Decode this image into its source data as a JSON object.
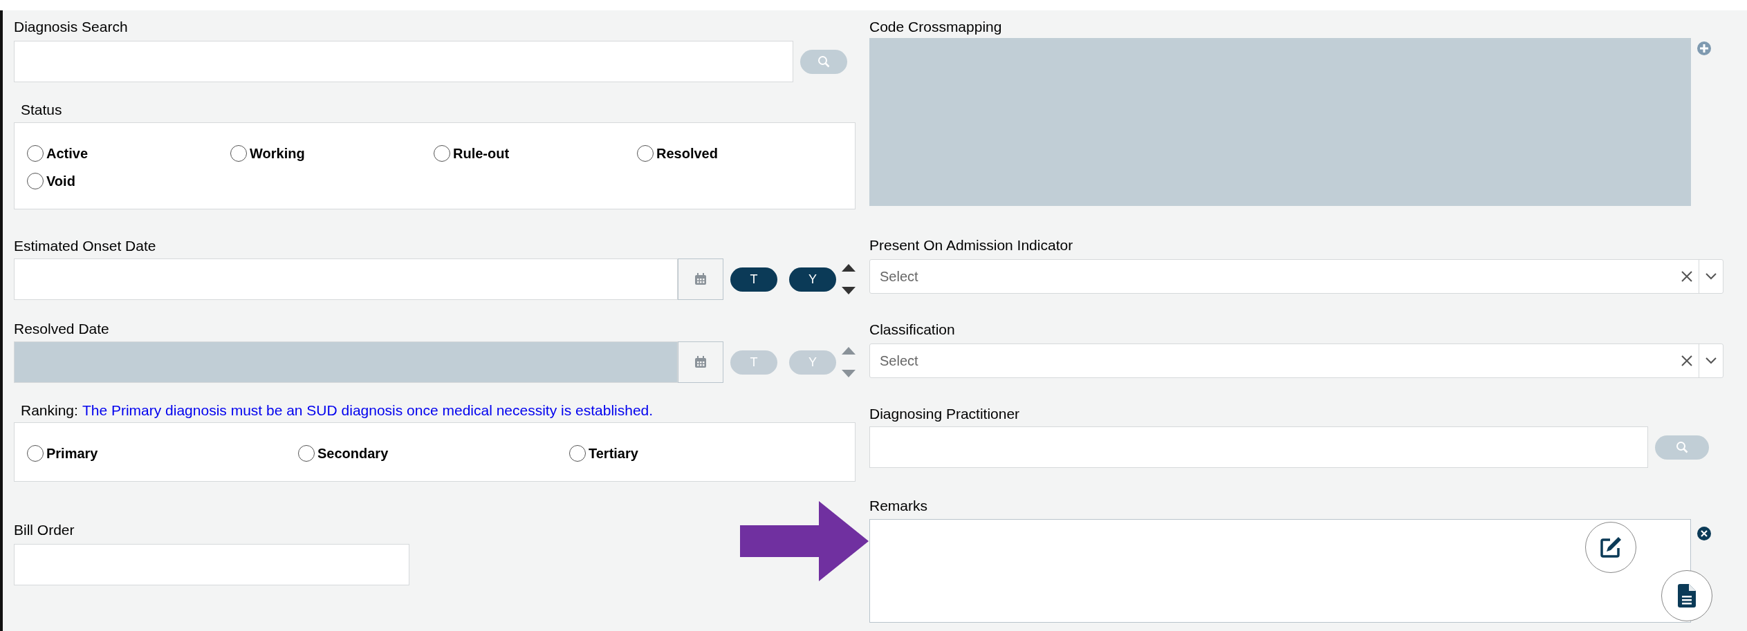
{
  "diagnosis_search": {
    "label": "Diagnosis Search"
  },
  "status": {
    "label": "Status",
    "options": [
      {
        "label": "Active",
        "selected": false
      },
      {
        "label": "Working",
        "selected": false
      },
      {
        "label": "Rule-out",
        "selected": false
      },
      {
        "label": "Resolved",
        "selected": false
      },
      {
        "label": "Void",
        "selected": false
      }
    ]
  },
  "date_fields": [
    {
      "label": "Estimated Onset Date",
      "disabled": false,
      "buttons": [
        "T",
        "Y"
      ]
    },
    {
      "label": "Resolved Date",
      "disabled": true,
      "buttons": [
        "T",
        "Y"
      ]
    }
  ],
  "ranking": {
    "label": "Ranking:",
    "note": "The Primary diagnosis must be an SUD diagnosis once medical necessity is established.",
    "options": [
      {
        "label": "Primary",
        "selected": false
      },
      {
        "label": "Secondary",
        "selected": false
      },
      {
        "label": "Tertiary",
        "selected": false
      }
    ]
  },
  "bill_order": {
    "label": "Bill Order"
  },
  "code_crossmapping": {
    "label": "Code Crossmapping"
  },
  "selects": [
    {
      "label": "Present On Admission Indicator",
      "placeholder": "Select"
    },
    {
      "label": "Classification",
      "placeholder": "Select"
    }
  ],
  "diagnosing_practitioner": {
    "label": "Diagnosing Practitioner"
  },
  "remarks": {
    "label": "Remarks"
  }
}
